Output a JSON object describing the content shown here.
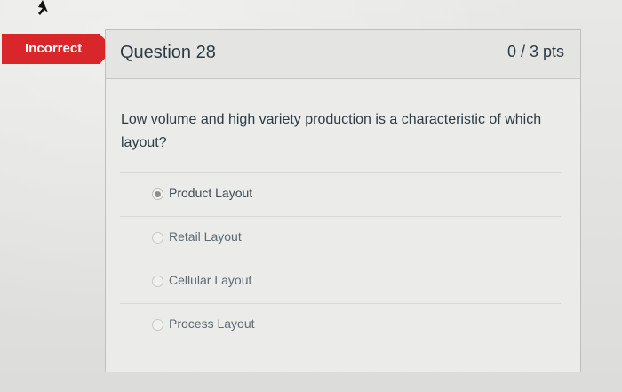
{
  "status": {
    "label": "Incorrect",
    "color": "#d9262b"
  },
  "question": {
    "title": "Question 28",
    "points": "0 / 3 pts",
    "text": "Low volume and high variety production is a characteristic of which layout?"
  },
  "answers": [
    {
      "label": "Product Layout",
      "selected": true
    },
    {
      "label": "Retail Layout",
      "selected": false
    },
    {
      "label": "Cellular Layout",
      "selected": false
    },
    {
      "label": "Process Layout",
      "selected": false
    }
  ],
  "icons": {
    "cursor": "mouse-pointer-icon"
  }
}
